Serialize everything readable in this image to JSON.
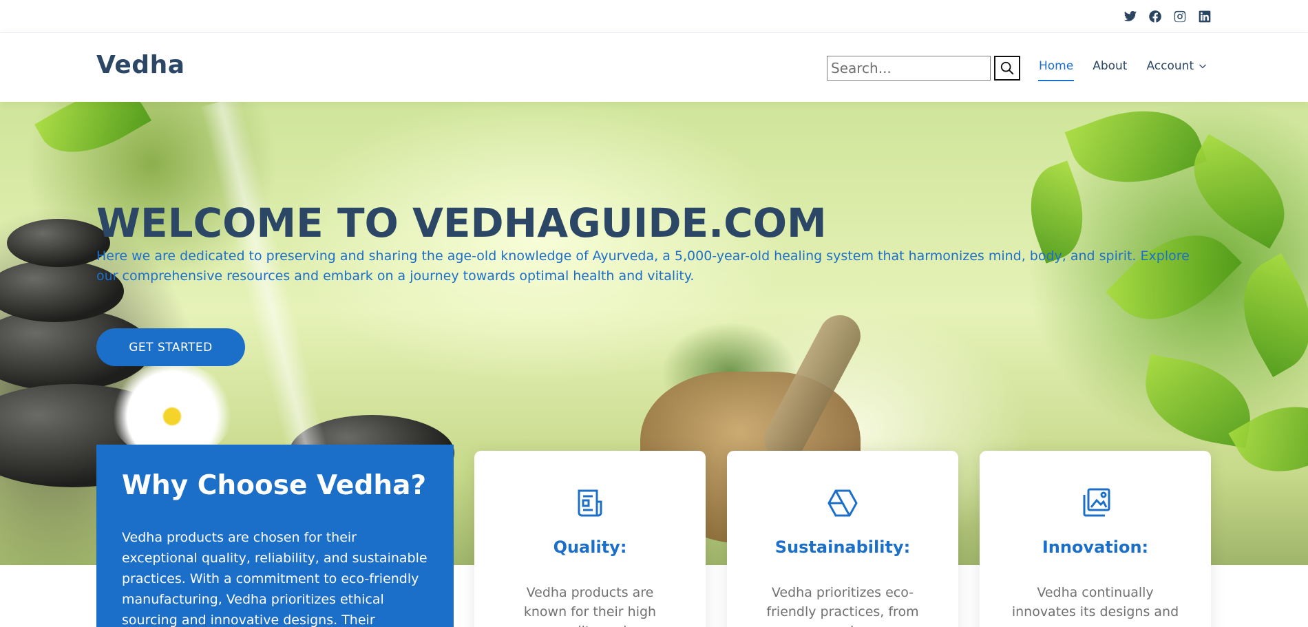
{
  "topbar": {
    "social": [
      {
        "icon": "twitter-icon"
      },
      {
        "icon": "facebook-icon"
      },
      {
        "icon": "instagram-icon"
      },
      {
        "icon": "linkedin-icon"
      }
    ]
  },
  "header": {
    "logo": "Vedha",
    "search": {
      "placeholder": "Search...",
      "value": ""
    },
    "nav": [
      {
        "label": "Home",
        "active": true
      },
      {
        "label": "About",
        "active": false
      },
      {
        "label": "Account",
        "active": false,
        "has_dropdown": true
      }
    ]
  },
  "hero": {
    "title": "WELCOME TO VEDHAGUIDE.COM",
    "text": "Here we are dedicated to preserving and sharing the age-old knowledge of Ayurveda, a 5,000-year-old healing system that harmonizes mind, body, and spirit. Explore our comprehensive resources and embark on a journey towards optimal health and vitality.",
    "cta": "GET STARTED"
  },
  "why": {
    "title": "Why Choose Vedha?",
    "text": "Vedha products are chosen for their exceptional quality, reliability, and sustainable practices. With a commitment to eco-friendly manufacturing, Vedha prioritizes ethical sourcing and innovative designs. Their"
  },
  "features": [
    {
      "icon": "document-icon",
      "title": "Quality:",
      "text": "Vedha products are known for their high quality and"
    },
    {
      "icon": "hexagon-icon",
      "title": "Sustainability:",
      "text": "Vedha prioritizes eco-friendly practices, from sourcing"
    },
    {
      "icon": "image-gallery-icon",
      "title": "Innovation:",
      "text": "Vedha continually innovates its designs and"
    }
  ],
  "colors": {
    "accent": "#1c6fc9",
    "heading": "#2c4766",
    "muted_text": "#717171"
  }
}
